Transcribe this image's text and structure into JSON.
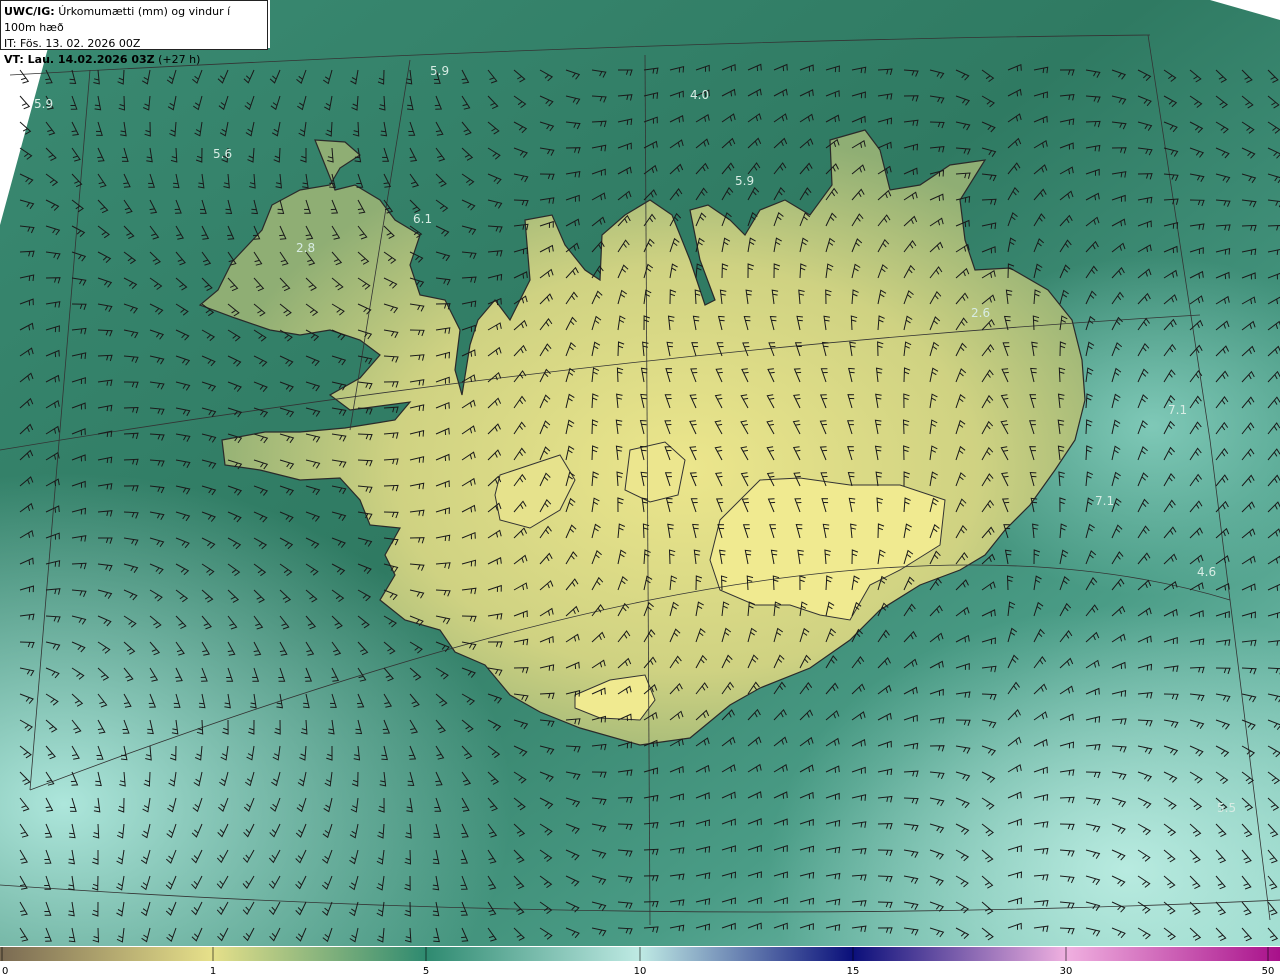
{
  "header": {
    "model": "UWC/IG:",
    "title": "Úrkomumætti (mm) og vindur í 100m hæð",
    "init_time": "IT: Fös. 13. 02. 2026 00Z",
    "valid_label": "VT: Lau. 14.02.2026 03Z",
    "valid_offset": "(+27 h)"
  },
  "value_labels": [
    {
      "text": "5.9"
    },
    {
      "text": "5.9"
    },
    {
      "text": "4.0"
    },
    {
      "text": "5.6"
    },
    {
      "text": "5.9"
    },
    {
      "text": "6.1"
    },
    {
      "text": "2.8"
    },
    {
      "text": "2.6"
    },
    {
      "text": "7.1"
    },
    {
      "text": "7.1"
    },
    {
      "text": "4.6"
    },
    {
      "text": "5.5"
    }
  ],
  "colorbar": {
    "ticks": [
      "0",
      "1",
      "5",
      "10",
      "15",
      "30",
      "50"
    ],
    "colors": [
      "#7a6a52",
      "#e6e08a",
      "#2e8a70",
      "#bfeae4",
      "#0a0f7a",
      "#f0b0e0",
      "#a8108a"
    ]
  },
  "palette": {
    "land_low": "#e8e28a",
    "land_high": "#9cb070",
    "sea_mid": "#3c8c6e",
    "sea_dark": "#2a6e58",
    "sea_light": "#9cdad0",
    "coast": "#2a2a2a",
    "barb": "#1a1a1a",
    "grid": "#333333"
  }
}
